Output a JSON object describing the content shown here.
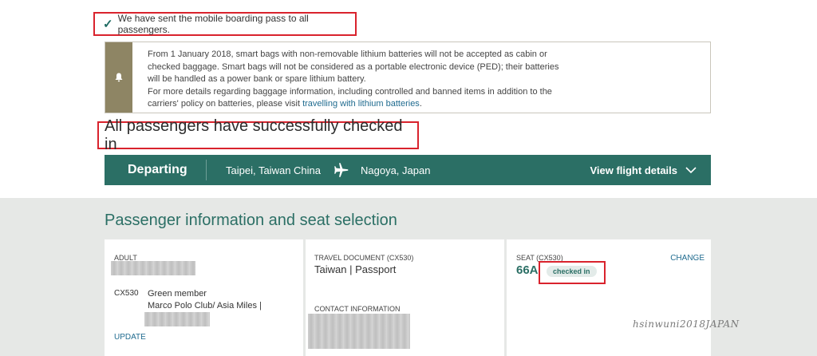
{
  "confirmation": {
    "text": "We have sent the mobile boarding pass to all passengers."
  },
  "notice": {
    "line1": "From 1 January 2018, smart bags with non-removable lithium batteries will not be accepted as cabin or",
    "line2": "checked baggage. Smart bags will not be considered as a portable electronic device (PED); their batteries",
    "line3": "will be handled as a power bank or spare lithium battery.",
    "line4": "For more details regarding baggage information, including controlled and banned items in addition to the",
    "line5_prefix": "carriers' policy on batteries, please visit ",
    "link": "travelling with lithium batteries",
    "line5_suffix": "."
  },
  "checkin_status": {
    "title": "All passengers have successfully checked in"
  },
  "flight": {
    "direction": "Departing",
    "origin": "Taipei, Taiwan China",
    "destination": "Nagoya, Japan",
    "details_label": "View flight details"
  },
  "passenger_section": {
    "title": "Passenger information and seat selection"
  },
  "passenger": {
    "type": "ADULT",
    "flight_no": "CX530",
    "membership_tier": "Green member",
    "program": "Marco Polo Club/ Asia Miles |",
    "update_label": "UPDATE"
  },
  "travel_document": {
    "label": "TRAVEL DOCUMENT (CX530)",
    "country": "Taiwan",
    "type": "Passport",
    "contact_label": "CONTACT INFORMATION"
  },
  "seat": {
    "label": "SEAT (CX530)",
    "number": "66A",
    "status": "checked in",
    "change_label": "CHANGE"
  },
  "watermark": "hsinwuni2018JAPAN",
  "colors": {
    "brand": "#2b6f65",
    "highlight": "#d9232d",
    "notice_bar": "#8e8564",
    "link": "#1f6b8f"
  }
}
